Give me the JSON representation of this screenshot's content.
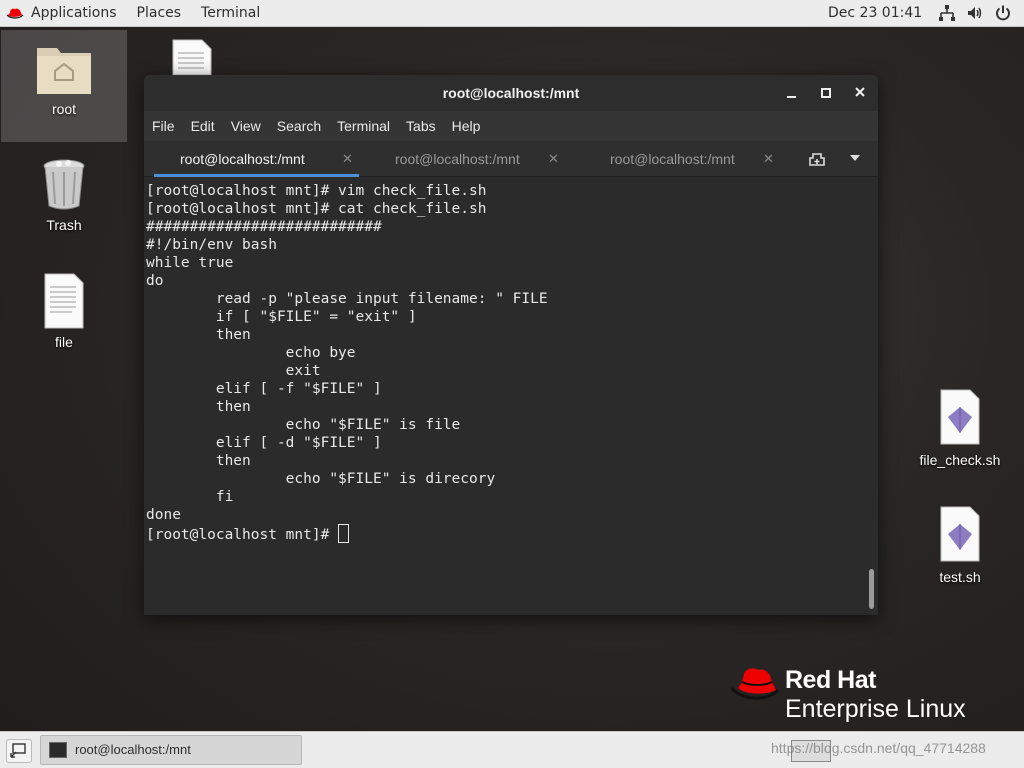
{
  "topbar": {
    "applications": "Applications",
    "places": "Places",
    "terminal": "Terminal",
    "clock": "Dec 23  01:41",
    "tray_icons": [
      "network-icon",
      "volume-icon",
      "power-icon"
    ]
  },
  "desktop": {
    "icons": {
      "root": "root",
      "trash": "Trash",
      "file": "file",
      "file_check": "file_check.sh",
      "test": "test.sh"
    }
  },
  "terminal_window": {
    "title": "root@localhost:/mnt",
    "menus": [
      "File",
      "Edit",
      "View",
      "Search",
      "Terminal",
      "Tabs",
      "Help"
    ],
    "tabs": [
      {
        "label": "root@localhost:/mnt",
        "active": true
      },
      {
        "label": "root@localhost:/mnt",
        "active": false
      },
      {
        "label": "root@localhost:/mnt",
        "active": false
      }
    ],
    "console_lines": [
      "[root@localhost mnt]# vim check_file.sh",
      "[root@localhost mnt]# cat check_file.sh",
      "###########################",
      "#!/bin/env bash",
      "while true",
      "do",
      "        read -p \"please input filename: \" FILE",
      "        if [ \"$FILE\" = \"exit\" ]",
      "        then",
      "                echo bye",
      "                exit",
      "        elif [ -f \"$FILE\" ]",
      "        then",
      "                echo \"$FILE\" is file",
      "        elif [ -d \"$FILE\" ]",
      "        then",
      "                echo \"$FILE\" is direcory",
      "        fi",
      "done"
    ],
    "prompt": "[root@localhost mnt]# "
  },
  "logo": {
    "line1": "Red Hat",
    "line2": "Enterprise Linux"
  },
  "taskbar": {
    "window_label": "root@localhost:/mnt",
    "watermark": "https://blog.csdn.net/qq_47714288"
  },
  "colors": {
    "accent": "#4a90d9",
    "redhat": "#ee0000"
  }
}
